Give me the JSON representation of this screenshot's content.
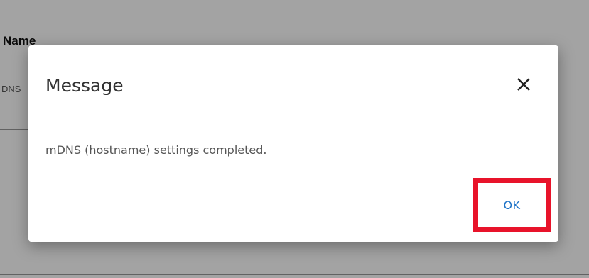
{
  "background": {
    "heading": "Name",
    "field_label_fragment": "DNS"
  },
  "dialog": {
    "title": "Message",
    "close_icon": "close-icon",
    "message": "mDNS (hostname) settings completed.",
    "ok_label": "OK",
    "highlight_color": "#e8132a",
    "ok_color": "#1f74c8"
  }
}
